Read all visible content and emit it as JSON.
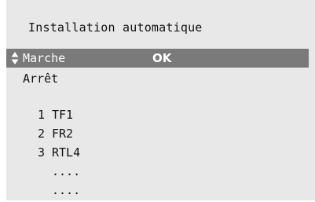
{
  "osd": {
    "title": "Installation automatique",
    "options": [
      {
        "label": "Marche",
        "selected": true,
        "status": "OK",
        "icon": "up-down-arrows-icon"
      },
      {
        "label": "Arrêt",
        "selected": false
      }
    ],
    "channels": [
      {
        "number": "1",
        "name": "TF1"
      },
      {
        "number": "2",
        "name": "FR2"
      },
      {
        "number": "3",
        "name": "RTL4"
      },
      {
        "number": "",
        "name": "...."
      },
      {
        "number": "",
        "name": "...."
      }
    ]
  },
  "colors": {
    "background": "#e8e8e8",
    "highlight": "#7a7a7a",
    "text": "#111111",
    "highlight_text": "#ffffff"
  }
}
